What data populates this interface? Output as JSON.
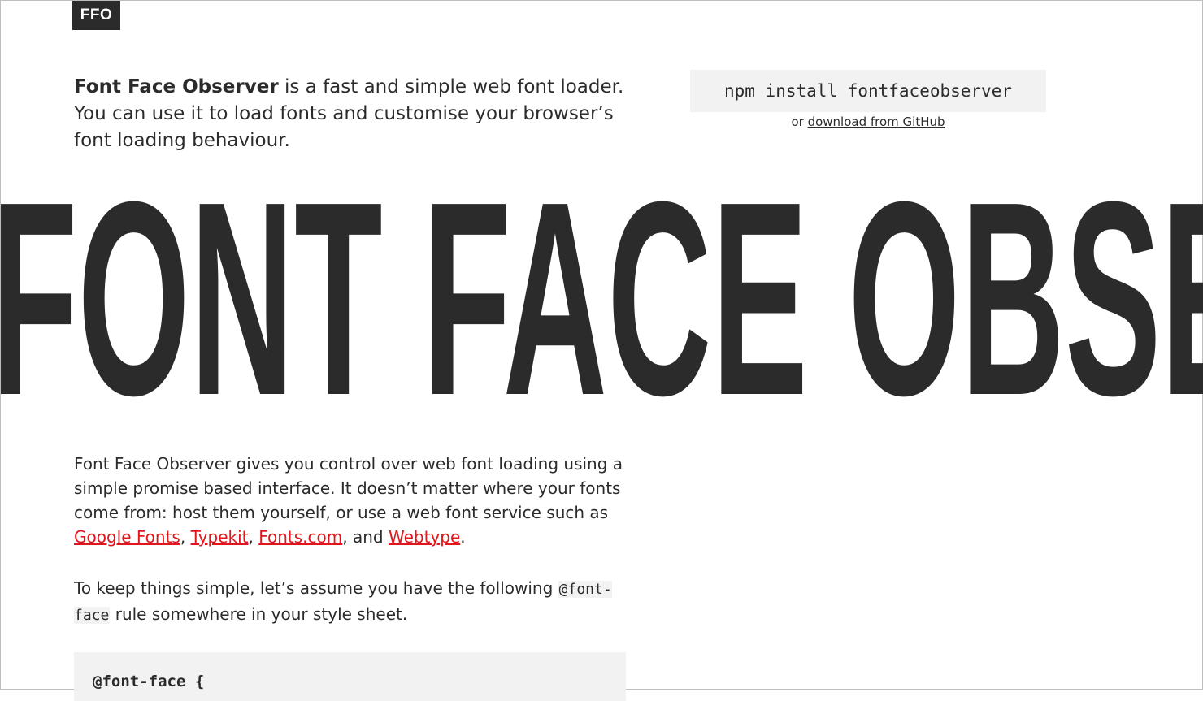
{
  "logo": {
    "text": "FFO"
  },
  "intro": {
    "strong": "Font Face Observer",
    "rest": " is a fast and simple web font loader. You can use it to load fonts and customise your browser’s font loading behaviour."
  },
  "install": {
    "command": "npm install fontfaceobserver",
    "prefix": "or ",
    "link_label": "download from GitHub"
  },
  "hero": {
    "text": "FONT FACE OBSE"
  },
  "para1": {
    "text_before": "Font Face Observer gives you control over web font loading using a simple promise based interface. It doesn’t matter where your fonts come from: host them yourself, or use a web font service such as ",
    "link1": "Google Fonts",
    "sep1": ", ",
    "link2": "Typekit",
    "sep2": ", ",
    "link3": "Fonts.com",
    "sep3": ", and ",
    "link4": "Webtype",
    "end": "."
  },
  "para2": {
    "text_before": "To keep things simple, let’s assume you have the following ",
    "code": "@font-face",
    "text_after": " rule somewhere in your style sheet."
  },
  "code_block": {
    "line1": "@font-face {"
  },
  "colors": {
    "text": "#2b2b2b",
    "link": "#e0161b",
    "code_bg": "#f2f2f2",
    "background": "#ffffff"
  }
}
